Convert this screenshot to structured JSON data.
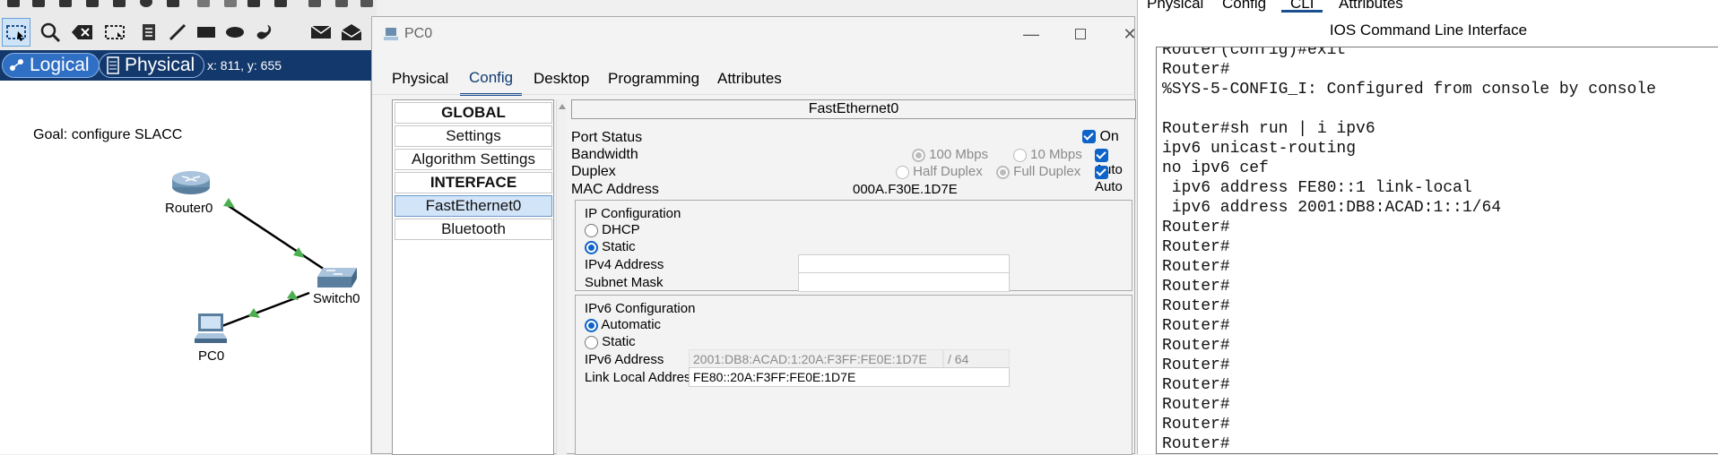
{
  "toolbar": {
    "tools": [
      {
        "name": "select-tool",
        "icon": "select-icon",
        "active": true
      },
      {
        "name": "inspect-tool",
        "icon": "magnifier-icon"
      },
      {
        "name": "delete-tool",
        "icon": "delete-icon"
      },
      {
        "name": "resize-tool",
        "icon": "resize-icon"
      },
      {
        "name": "note-tool",
        "icon": "note-icon"
      },
      {
        "name": "line-tool",
        "icon": "line-icon"
      },
      {
        "name": "rectangle-tool",
        "icon": "rectangle-icon"
      },
      {
        "name": "ellipse-tool",
        "icon": "ellipse-icon"
      },
      {
        "name": "freeform-tool",
        "icon": "freeform-icon"
      },
      {
        "name": "simple-pdu-tool",
        "icon": "closed-envelope-icon"
      },
      {
        "name": "complex-pdu-tool",
        "icon": "open-envelope-icon"
      }
    ]
  },
  "modebar": {
    "logical_label": "Logical",
    "physical_label": "Physical",
    "coords": "x: 811, y: 655"
  },
  "workspace": {
    "goal": "Goal: configure SLACC",
    "devices": {
      "router": "Router0",
      "switch": "Switch0",
      "pc": "PC0"
    },
    "link_color": "#000000",
    "link_up_color": "#4caf50"
  },
  "pc0": {
    "title": "PC0",
    "tabs": [
      "Physical",
      "Config",
      "Desktop",
      "Programming",
      "Attributes"
    ],
    "active_tab": "Config",
    "nav": [
      "GLOBAL",
      "Settings",
      "Algorithm Settings",
      "INTERFACE",
      "FastEthernet0",
      "Bluetooth"
    ],
    "selected_nav": "FastEthernet0",
    "pane_title": "FastEthernet0",
    "port_status_label": "Port Status",
    "port_status_on": "On",
    "bandwidth_label": "Bandwidth",
    "bandwidth_100": "100 Mbps",
    "bandwidth_10": "10 Mbps",
    "bandwidth_auto": "Auto",
    "duplex_label": "Duplex",
    "duplex_half": "Half Duplex",
    "duplex_full": "Full Duplex",
    "duplex_auto": "Auto",
    "mac_label": "MAC Address",
    "mac_value": "000A.F30E.1D7E",
    "ip_config_title": "IP Configuration",
    "dhcp_label": "DHCP",
    "static_label": "Static",
    "ipv4_label": "IPv4 Address",
    "ipv4_value": "",
    "mask_label": "Subnet Mask",
    "mask_value": "",
    "ipv6_config_title": "IPv6 Configuration",
    "automatic_label": "Automatic",
    "static6_label": "Static",
    "ipv6_label": "IPv6 Address",
    "ipv6_value": "2001:DB8:ACAD:1:20A:F3FF:FE0E:1D7E",
    "ipv6_prefix": "/ 64",
    "link_local_label": "Link Local Address:",
    "link_local_value": "FE80::20A:F3FF:FE0E:1D7E"
  },
  "cli": {
    "tabs": [
      "Physical",
      "Config",
      "CLI",
      "Attributes"
    ],
    "active_tab": "CLI",
    "title": "IOS Command Line Interface",
    "lines": [
      "Router(config)#exit",
      "Router#",
      "%SYS-5-CONFIG_I: Configured from console by console",
      "",
      "Router#sh run | i ipv6",
      "ipv6 unicast-routing",
      "no ipv6 cef",
      " ipv6 address FE80::1 link-local",
      " ipv6 address 2001:DB8:ACAD:1::1/64",
      "Router#",
      "Router#",
      "Router#",
      "Router#",
      "Router#",
      "Router#",
      "Router#",
      "Router#",
      "Router#",
      "Router#",
      "Router#",
      "Router#"
    ]
  }
}
